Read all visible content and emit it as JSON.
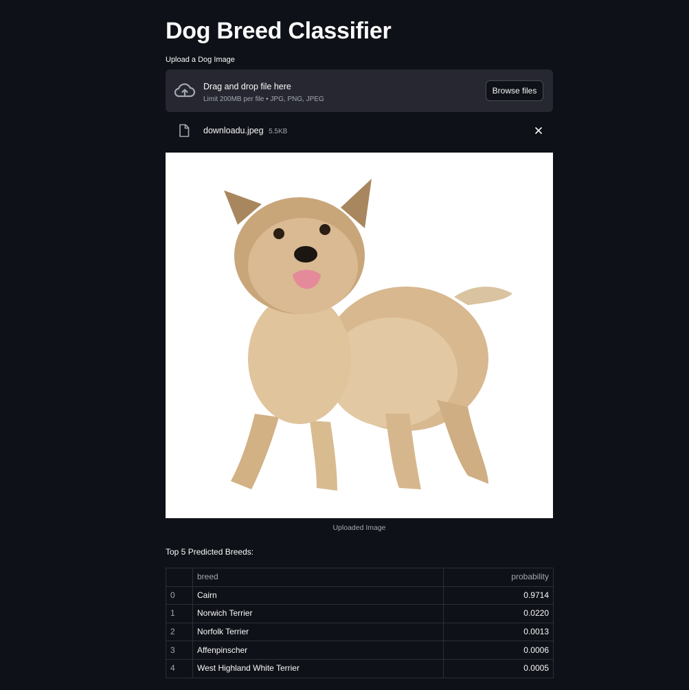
{
  "page": {
    "title": "Dog Breed Classifier"
  },
  "uploader": {
    "label": "Upload a Dog Image",
    "drag_text": "Drag and drop file here",
    "limit_text": "Limit 200MB per file • JPG, PNG, JPEG",
    "browse_label": "Browse files",
    "icons": {
      "upload": "cloud-upload-icon",
      "file": "file-icon",
      "remove": "close-icon"
    }
  },
  "uploaded_file": {
    "name": "downloadu.jpeg",
    "size": "5.5KB"
  },
  "image": {
    "caption": "Uploaded Image",
    "subject": "dog-photo"
  },
  "results": {
    "heading": "Top 5 Predicted Breeds:",
    "columns": [
      "",
      "breed",
      "probability"
    ],
    "rows": [
      {
        "index": "0",
        "breed": "Cairn",
        "probability": "0.9714"
      },
      {
        "index": "1",
        "breed": "Norwich Terrier",
        "probability": "0.0220"
      },
      {
        "index": "2",
        "breed": "Norfolk Terrier",
        "probability": "0.0013"
      },
      {
        "index": "3",
        "breed": "Affenpinscher",
        "probability": "0.0006"
      },
      {
        "index": "4",
        "breed": "West Highland White Terrier",
        "probability": "0.0005"
      }
    ]
  },
  "colors": {
    "background": "#0e1117",
    "dropzone": "#262730",
    "text": "#fafafa",
    "muted": "#a3a8b4",
    "table_border": "#2d2f38"
  }
}
